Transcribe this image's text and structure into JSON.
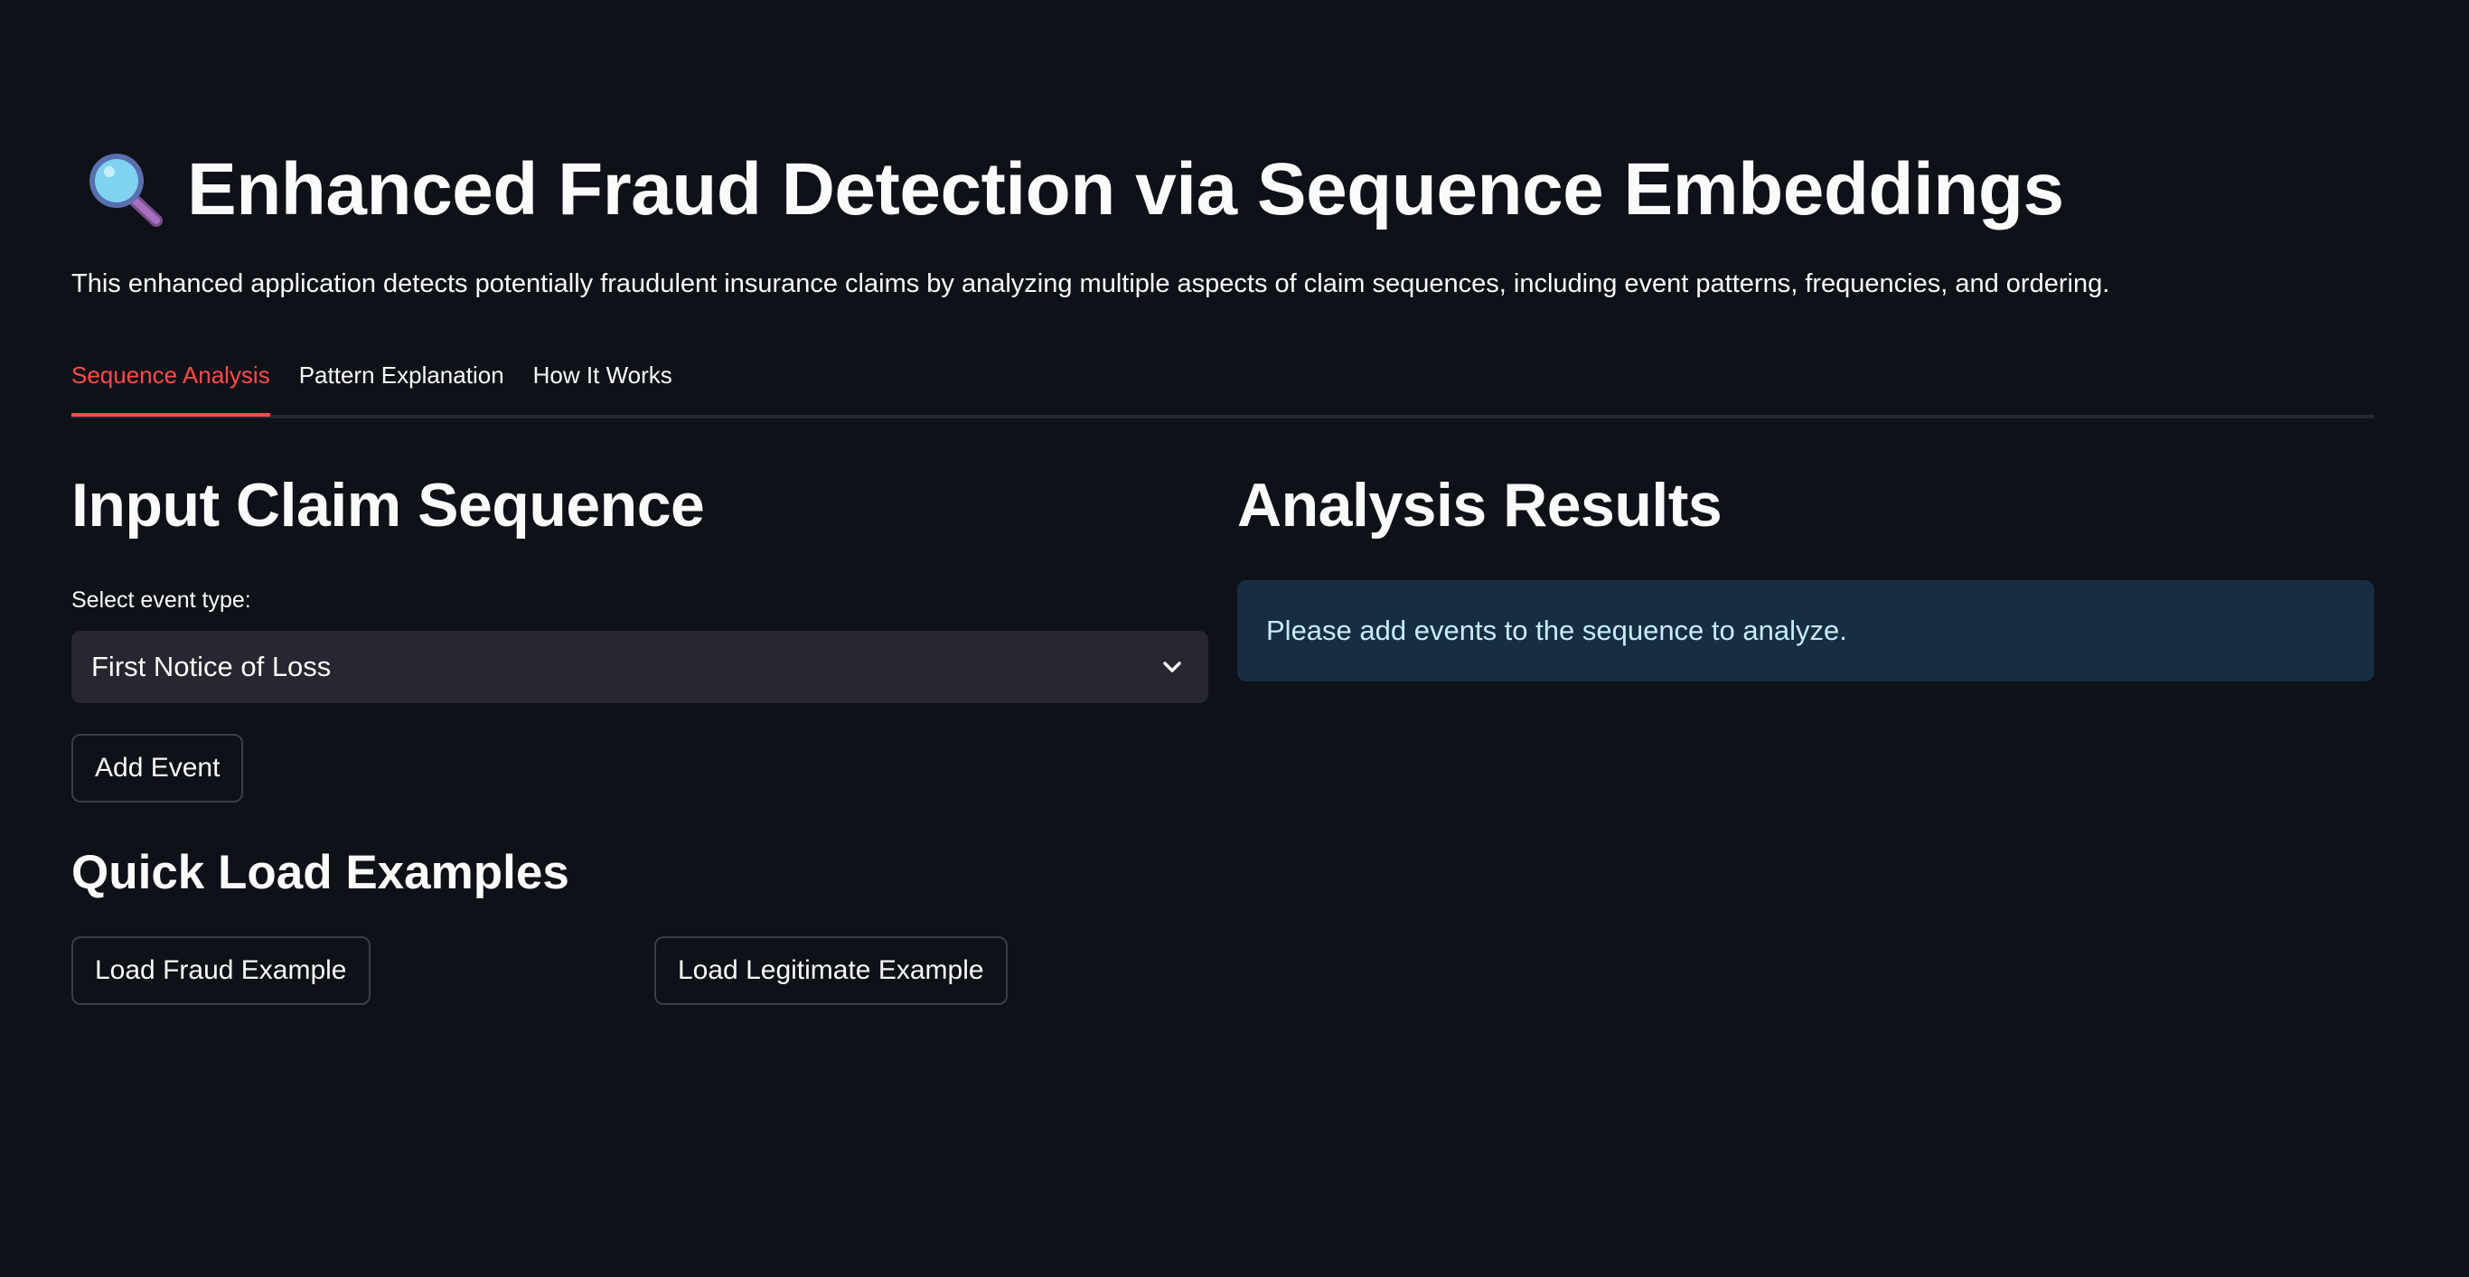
{
  "header": {
    "icon": "magnifying-glass-icon",
    "title": "Enhanced Fraud Detection via Sequence Embeddings",
    "subtitle": "This enhanced application detects potentially fraudulent insurance claims by analyzing multiple aspects of claim sequences, including event patterns, frequencies, and ordering."
  },
  "tabs": [
    {
      "label": "Sequence Analysis",
      "active": true
    },
    {
      "label": "Pattern Explanation",
      "active": false
    },
    {
      "label": "How It Works",
      "active": false
    }
  ],
  "input_panel": {
    "heading": "Input Claim Sequence",
    "select_label": "Select event type:",
    "select_value": "First Notice of Loss",
    "add_button": "Add Event",
    "quick_heading": "Quick Load Examples",
    "fraud_button": "Load Fraud Example",
    "legit_button": "Load Legitimate Example"
  },
  "results_panel": {
    "heading": "Analysis Results",
    "info_message": "Please add events to the sequence to analyze."
  },
  "colors": {
    "background": "#0e1117",
    "accent": "#ff4b4b",
    "info_bg": "#172d43",
    "info_text": "#c7ebff",
    "widget_bg": "#262730"
  }
}
